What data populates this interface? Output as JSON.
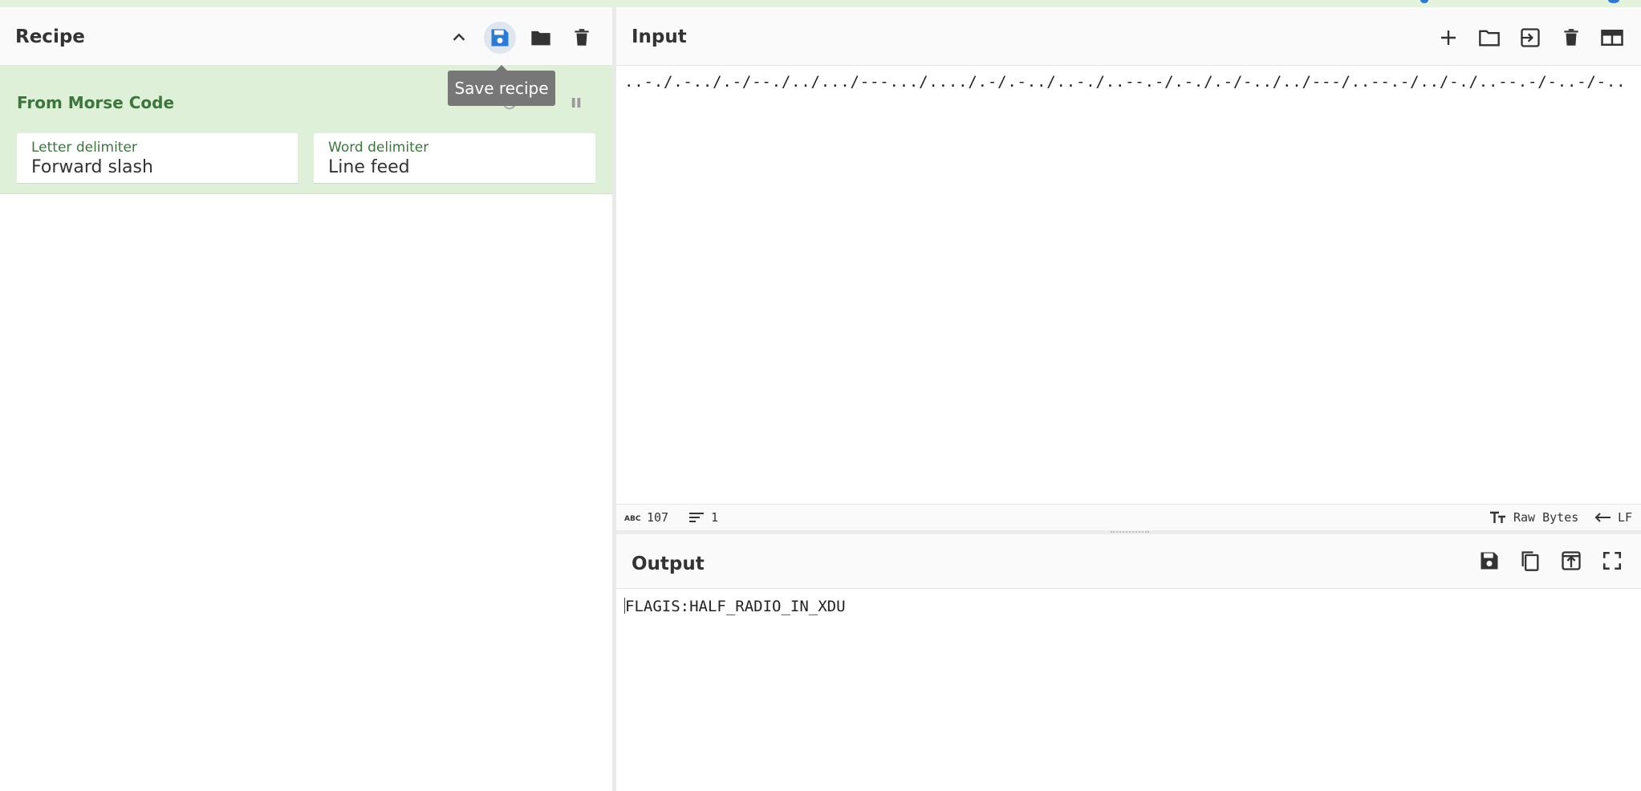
{
  "colors": {
    "accent_green": "#3c763d",
    "operation_bg": "#dff0d8",
    "save_blue": "#2a7ad6",
    "icon_dark": "#333333"
  },
  "recipe": {
    "title": "Recipe",
    "buttons": [
      "chevron-up-icon",
      "save-icon",
      "folder-icon",
      "trash-icon"
    ],
    "tooltip": "Save recipe",
    "operation": {
      "name": "From Morse Code",
      "fields": [
        {
          "label": "Letter delimiter",
          "value": "Forward slash"
        },
        {
          "label": "Word delimiter",
          "value": "Line feed"
        }
      ]
    }
  },
  "input": {
    "title": "Input",
    "buttons": [
      "plus-icon",
      "folder-icon",
      "import-icon",
      "trash-icon",
      "layout-icon"
    ],
    "text": "..-./.-../.-/--./../.../---.../..../.-/.-../..-./..--.-/.-./.-/-../../---/..--.-/../-./..--.-/-..-/-../..-/",
    "status": {
      "length_icon": "abc-icon",
      "length": "107",
      "lines_icon": "lines-icon",
      "lines": "1",
      "encoding": "Raw Bytes",
      "eol": "LF"
    }
  },
  "output": {
    "title": "Output",
    "buttons": [
      "save-icon",
      "copy-icon",
      "replace-input-icon",
      "maximize-icon"
    ],
    "text": "FLAGIS:HALF_RADIO_IN_XDU"
  }
}
